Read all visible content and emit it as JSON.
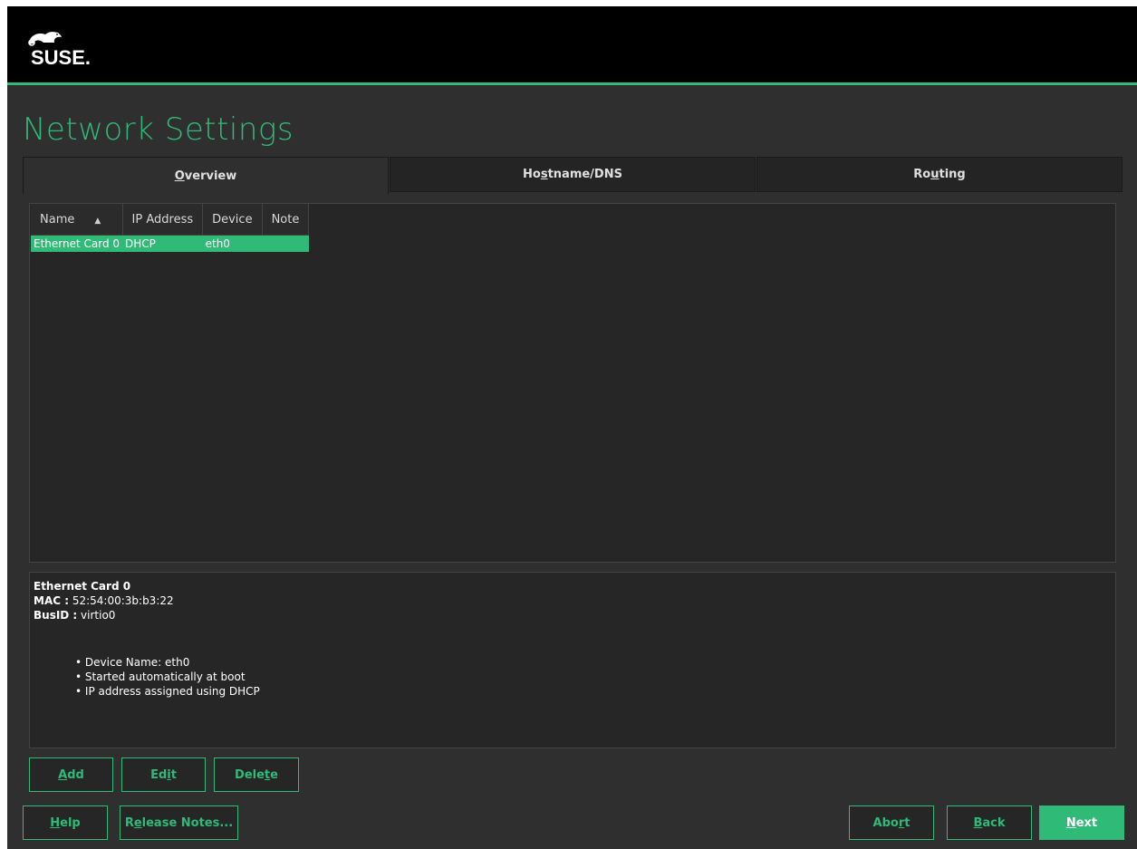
{
  "brand": {
    "logo_text": "SUSE.",
    "accent": "#30ba78"
  },
  "page": {
    "title": "Network Settings"
  },
  "tabs": [
    {
      "pre": "",
      "key": "O",
      "post": "verview"
    },
    {
      "pre": "Ho",
      "key": "s",
      "post": "tname/DNS"
    },
    {
      "pre": "Ro",
      "key": "u",
      "post": "ting"
    }
  ],
  "table": {
    "columns": [
      "Name",
      "IP Address",
      "Device",
      "Note"
    ],
    "sort_icon": "sort-up-icon",
    "rows": [
      {
        "name": "Ethernet Card 0",
        "ip": "DHCP",
        "device": "eth0",
        "note": ""
      }
    ]
  },
  "details": {
    "title": "Ethernet Card 0",
    "mac_label": "MAC :",
    "mac_value": " 52:54:00:3b:b3:22",
    "busid_label": "BusID :",
    "busid_value": " virtio0",
    "bullets": [
      "Device Name: eth0",
      "Started automatically at boot",
      "IP address assigned using DHCP"
    ]
  },
  "actions": {
    "add": {
      "pre": "",
      "key": "A",
      "post": "dd"
    },
    "edit": {
      "pre": "Ed",
      "key": "i",
      "post": "t"
    },
    "delete": {
      "pre": "Dele",
      "key": "t",
      "post": "e"
    }
  },
  "footer": {
    "help": {
      "pre": "",
      "key": "H",
      "post": "elp"
    },
    "release_notes": {
      "pre": "R",
      "key": "e",
      "post": "lease Notes..."
    },
    "abort": {
      "pre": "Abo",
      "key": "r",
      "post": "t"
    },
    "back": {
      "pre": "",
      "key": "B",
      "post": "ack"
    },
    "next": {
      "pre": "",
      "key": "N",
      "post": "ext"
    }
  }
}
